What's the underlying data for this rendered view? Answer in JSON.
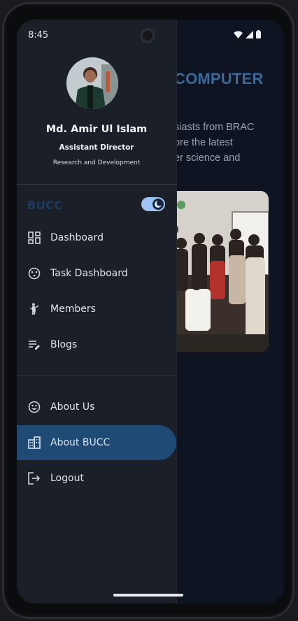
{
  "status_bar": {
    "time": "8:45"
  },
  "background_page": {
    "title_fragment": "COMPUTER",
    "paragraph_lines": [
      "siasts from BRAC",
      "ore the latest",
      "er science and"
    ]
  },
  "drawer": {
    "user": {
      "name": "Md. Amir Ul Islam",
      "role": "Assistant Director",
      "department": "Research and Development"
    },
    "brand": "BUCC",
    "theme_toggle": {
      "on": true
    },
    "primary_nav": [
      {
        "label": "Dashboard",
        "icon": "dashboard-icon"
      },
      {
        "label": "Task Dashboard",
        "icon": "task-icon"
      },
      {
        "label": "Members",
        "icon": "members-icon"
      },
      {
        "label": "Blogs",
        "icon": "blogs-icon"
      }
    ],
    "secondary_nav": [
      {
        "label": "About Us",
        "icon": "about-us-icon"
      },
      {
        "label": "About BUCC",
        "icon": "building-icon",
        "active": true
      },
      {
        "label": "Logout",
        "icon": "logout-icon"
      }
    ]
  },
  "colors": {
    "drawer_bg": "#1b1f28",
    "active_item_bg": "#1e4a75",
    "brand_text": "#1f3b63",
    "toggle_track": "#9dc3f5",
    "bg_title": "#3b6a9a"
  }
}
